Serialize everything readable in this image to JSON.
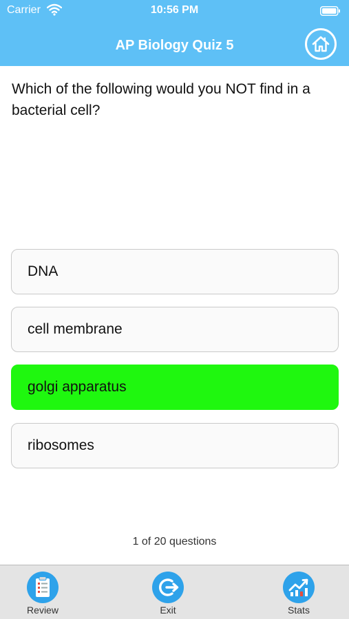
{
  "status_bar": {
    "carrier": "Carrier",
    "time": "10:56 PM"
  },
  "header": {
    "title": "AP Biology Quiz 5",
    "home_icon": "home-icon"
  },
  "question": {
    "text": "Which of the following would you NOT find in a bacterial cell?"
  },
  "answers": [
    {
      "label": "DNA",
      "state": "default"
    },
    {
      "label": "cell membrane",
      "state": "default"
    },
    {
      "label": "golgi apparatus",
      "state": "correct"
    },
    {
      "label": "ribosomes",
      "state": "default"
    }
  ],
  "progress": {
    "text": "1 of 20 questions",
    "current": 1,
    "total": 20
  },
  "tabbar": {
    "review": {
      "label": "Review",
      "icon": "clipboard-icon"
    },
    "exit": {
      "label": "Exit",
      "icon": "exit-icon"
    },
    "stats": {
      "label": "Stats",
      "icon": "chart-icon"
    }
  },
  "colors": {
    "header": "#5ec0f6",
    "correct": "#1ff70f",
    "tab_icon": "#2ea2ea"
  }
}
